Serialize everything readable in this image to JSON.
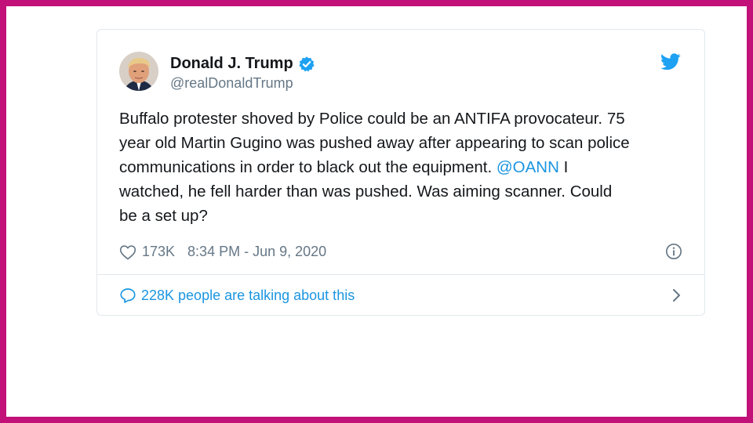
{
  "tweet": {
    "display_name": "Donald J. Trump",
    "handle": "@realDonaldTrump",
    "verified": true,
    "text_lines": [
      "Buffalo protester shoved by Police could be an ANTIFA provocateur. 75",
      "year old Martin Gugino was pushed away after appearing to scan police",
      "communications in order to black out the equipment. ",
      " I",
      "watched, he fell harder than was pushed. Was aiming scanner. Could",
      "be a set up?"
    ],
    "mention": "@OANN",
    "likes": "173K",
    "timestamp": "8:34 PM - Jun 9, 2020",
    "conversation": "228K people are talking about this"
  },
  "colors": {
    "frame": "#c2127a",
    "twitter_blue": "#1da1f2",
    "link": "#1b95e0",
    "muted": "#657786"
  },
  "icons": {
    "verified": "verified-badge-icon",
    "brand": "twitter-bird-icon",
    "like": "heart-icon",
    "info": "info-icon",
    "reply": "speech-bubble-icon",
    "more": "chevron-right-icon"
  }
}
